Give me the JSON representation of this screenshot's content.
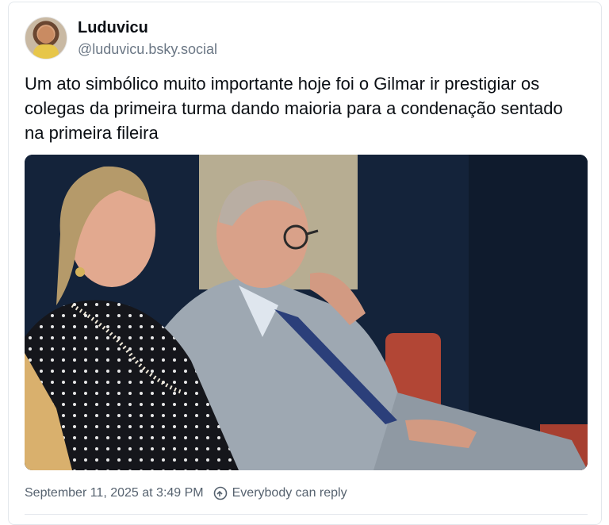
{
  "post": {
    "author_name": "Luduvicu",
    "author_handle": "@luduvicu.bsky.social",
    "text": "Um ato simbólico muito importante hoje foi o Gilmar ir prestigiar os colegas da primeira turma dando maioria para a condenação sentado na primeira fileira",
    "timestamp": "September 11, 2025 at 3:49 PM",
    "reply_setting": "Everybody can reply",
    "reply_icon": "reply-settings-icon"
  },
  "colors": {
    "text_primary": "#0b0f14",
    "text_secondary": "#6b7785",
    "border": "#e3e7ec"
  }
}
